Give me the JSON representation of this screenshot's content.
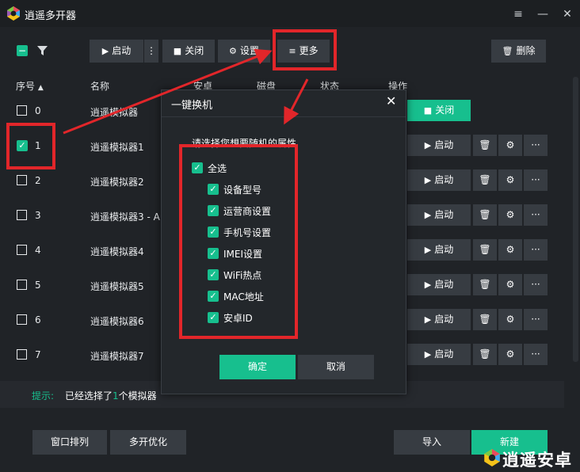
{
  "window": {
    "title": "逍遥多开器",
    "min_icon": "≡",
    "minimize": "—",
    "close": "✕"
  },
  "toolbar": {
    "start": "启动",
    "more_dots": "⋮",
    "close": "关闭",
    "settings": "设置",
    "more": "更多",
    "delete": "删除"
  },
  "header": {
    "index": "序号",
    "name": "名称",
    "android": "安卓",
    "disk": "磁盘",
    "status": "状态",
    "ops": "操作"
  },
  "rows": [
    {
      "index": "0",
      "name": "逍遥模拟器",
      "action": "关闭",
      "checked": false
    },
    {
      "index": "1",
      "name": "逍遥模拟器1",
      "action": "启动",
      "checked": true
    },
    {
      "index": "2",
      "name": "逍遥模拟器2",
      "action": "启动",
      "checked": false
    },
    {
      "index": "3",
      "name": "逍遥模拟器3 - A",
      "action": "启动",
      "checked": false
    },
    {
      "index": "4",
      "name": "逍遥模拟器4",
      "action": "启动",
      "checked": false
    },
    {
      "index": "5",
      "name": "逍遥模拟器5",
      "action": "启动",
      "checked": false
    },
    {
      "index": "6",
      "name": "逍遥模拟器6",
      "action": "启动",
      "checked": false
    },
    {
      "index": "7",
      "name": "逍遥模拟器7",
      "action": "启动",
      "checked": false
    }
  ],
  "hint": {
    "label": "提示:",
    "pre": "已经选择了",
    "count": "1",
    "post": "个模拟器"
  },
  "bottom": {
    "arrange": "窗口排列",
    "optimize": "多开优化",
    "import": "导入",
    "new": "新建"
  },
  "dialog": {
    "title": "一键换机",
    "close": "✕",
    "prompt": "请选择您想要随机的属性",
    "select_all": "全选",
    "options": [
      "设备型号",
      "运营商设置",
      "手机号设置",
      "IMEI设置",
      "WiFi热点",
      "MAC地址",
      "安卓ID"
    ],
    "ok": "确定",
    "cancel": "取消"
  },
  "brand": {
    "text": "逍遥安卓"
  },
  "colors": {
    "accent": "#17bf8e",
    "background": "#202327",
    "highlight": "#e2262a"
  }
}
